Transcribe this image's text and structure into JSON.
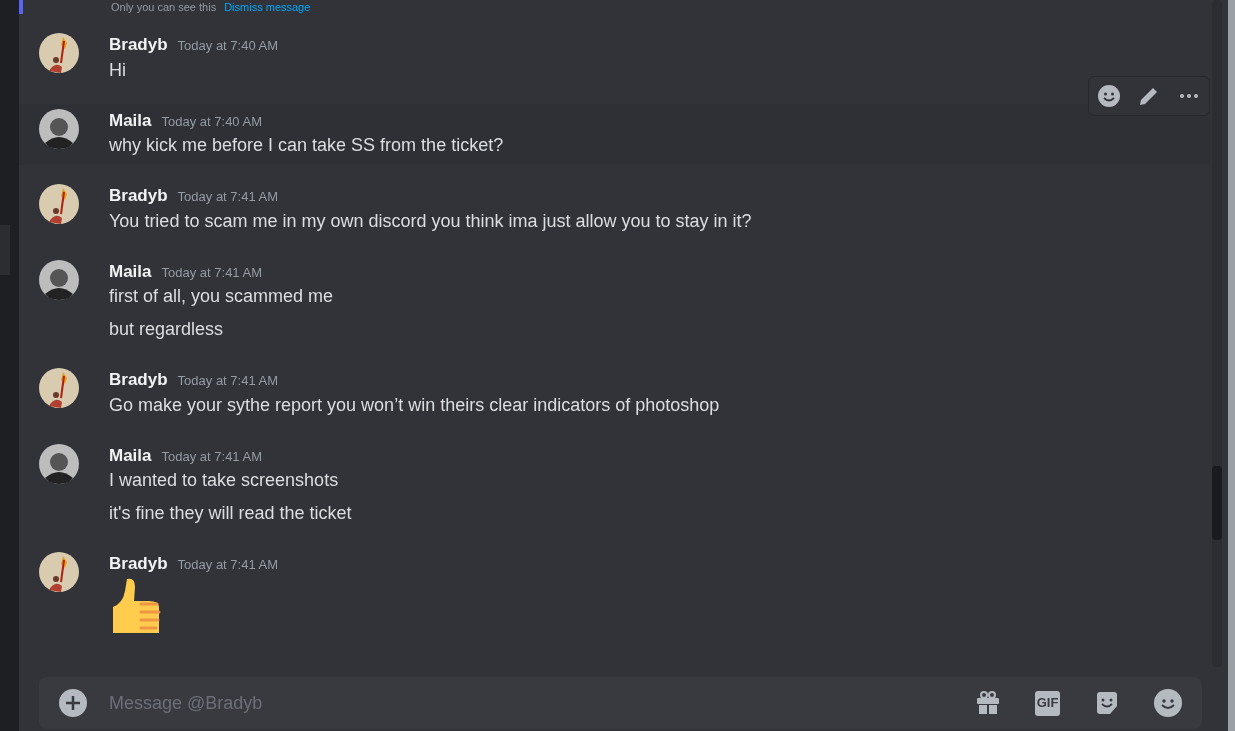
{
  "system_notice": {
    "text": "Only you can see this",
    "link": "Dismiss message"
  },
  "messages": [
    {
      "author": "Bradyb",
      "time": "Today at 7:40 AM",
      "kind": "text",
      "hovered": false,
      "lines": [
        "Hi"
      ]
    },
    {
      "author": "Maila",
      "time": "Today at 7:40 AM",
      "kind": "text",
      "hovered": true,
      "lines": [
        "why kick me before I can take SS from the ticket?"
      ]
    },
    {
      "author": "Bradyb",
      "time": "Today at 7:41 AM",
      "kind": "text",
      "hovered": false,
      "lines": [
        "You tried to scam me in my own discord you think ima just allow you to stay in it?"
      ]
    },
    {
      "author": "Maila",
      "time": "Today at 7:41 AM",
      "kind": "text",
      "hovered": false,
      "lines": [
        "first of all, you scammed me",
        "but regardless"
      ]
    },
    {
      "author": "Bradyb",
      "time": "Today at 7:41 AM",
      "kind": "text",
      "hovered": false,
      "lines": [
        "Go make your sythe report you won’t win theirs clear indicators of photoshop"
      ]
    },
    {
      "author": "Maila",
      "time": "Today at 7:41 AM",
      "kind": "text",
      "hovered": false,
      "lines": [
        "I wanted to take screenshots",
        "it's fine they will read the ticket"
      ]
    },
    {
      "author": "Bradyb",
      "time": "Today at 7:41 AM",
      "kind": "emoji",
      "hovered": false
    }
  ],
  "composer": {
    "placeholder": "Message @Bradyb",
    "gif_label": "GIF"
  }
}
